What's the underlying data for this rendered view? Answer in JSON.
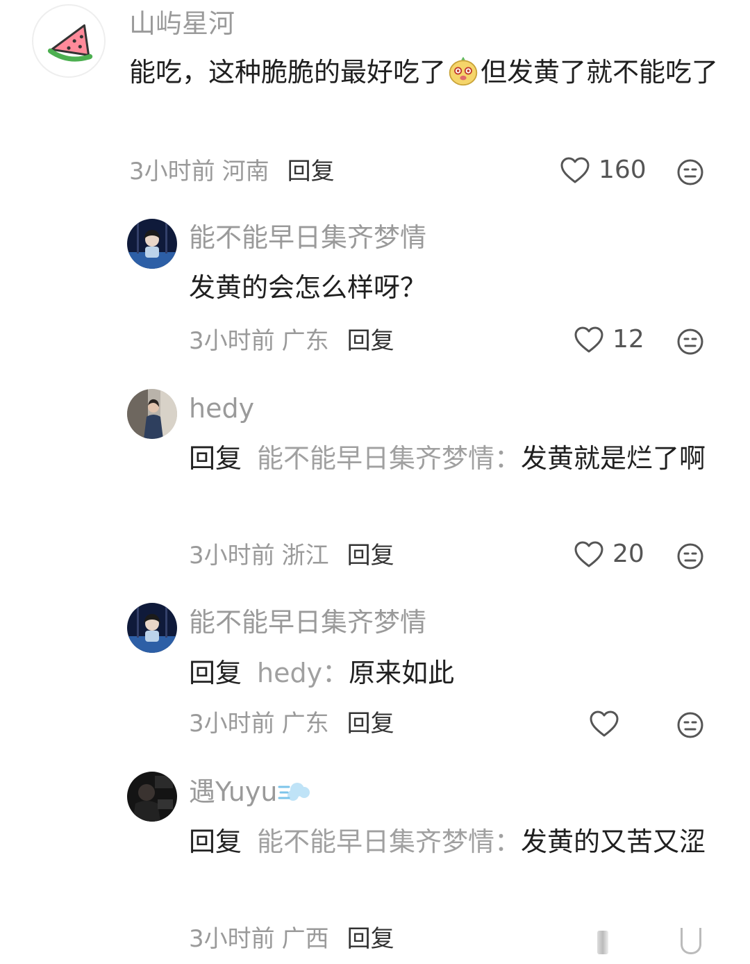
{
  "comments": [
    {
      "username": "山屿星河",
      "text_a": "能吃，这种脆脆的最好吃了",
      "text_b": "但发黄了就不能吃了",
      "time": "3小时前",
      "location": "河南",
      "reply_label": "回复",
      "likes": "160",
      "avatar_icon": "watermelon-icon"
    },
    {
      "username": "能不能早日集齐梦情",
      "text": "发黄的会怎么样呀？",
      "time": "3小时前",
      "location": "广东",
      "reply_label": "回复",
      "likes": "12"
    },
    {
      "username": "hedy",
      "reply_prefix": "回复",
      "reply_to": "能不能早日集齐梦情：",
      "text": "发黄就是烂了啊",
      "time": "3小时前",
      "location": "浙江",
      "reply_label": "回复",
      "likes": "20"
    },
    {
      "username": "能不能早日集齐梦情",
      "reply_prefix": "回复",
      "reply_to": "hedy：",
      "text": "原来如此",
      "time": "3小时前",
      "location": "广东",
      "reply_label": "回复",
      "likes": ""
    },
    {
      "username": "遇Yuyu",
      "username_emoji": "dash-icon",
      "reply_prefix": "回复",
      "reply_to": "能不能早日集齐梦情：",
      "text": "发黄的又苦又涩",
      "time": "3小时前",
      "location": "广西",
      "reply_label": "回复"
    }
  ],
  "colors": {
    "muted": "#9a9a9a",
    "text": "#1f1f1f"
  }
}
